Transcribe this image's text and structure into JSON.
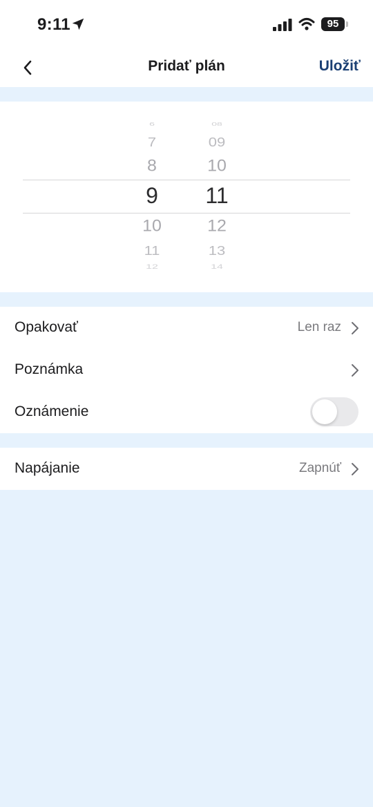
{
  "status_bar": {
    "time": "9:11",
    "battery_level": "95",
    "icons": [
      "location-arrow-icon",
      "signal-icon",
      "wifi-icon",
      "battery-icon"
    ]
  },
  "nav": {
    "back_icon": "chevron-left-icon",
    "title": "Pridať plán",
    "save_label": "Uložiť"
  },
  "time_picker": {
    "hours": [
      "6",
      "7",
      "8",
      "9",
      "10",
      "11",
      "12"
    ],
    "minutes": [
      "08",
      "09",
      "10",
      "11",
      "12",
      "13",
      "14"
    ],
    "selected_hour": "9",
    "selected_minute": "11"
  },
  "settings": {
    "repeat": {
      "label": "Opakovať",
      "value": "Len raz"
    },
    "note": {
      "label": "Poznámka"
    },
    "notification": {
      "label": "Oznámenie",
      "enabled": false
    }
  },
  "power": {
    "label": "Napájanie",
    "value": "Zapnúť"
  },
  "colors": {
    "accent": "#1a3f73",
    "background": "#e6f2fd",
    "card": "#ffffff",
    "secondary_text": "#7a7a7e"
  }
}
